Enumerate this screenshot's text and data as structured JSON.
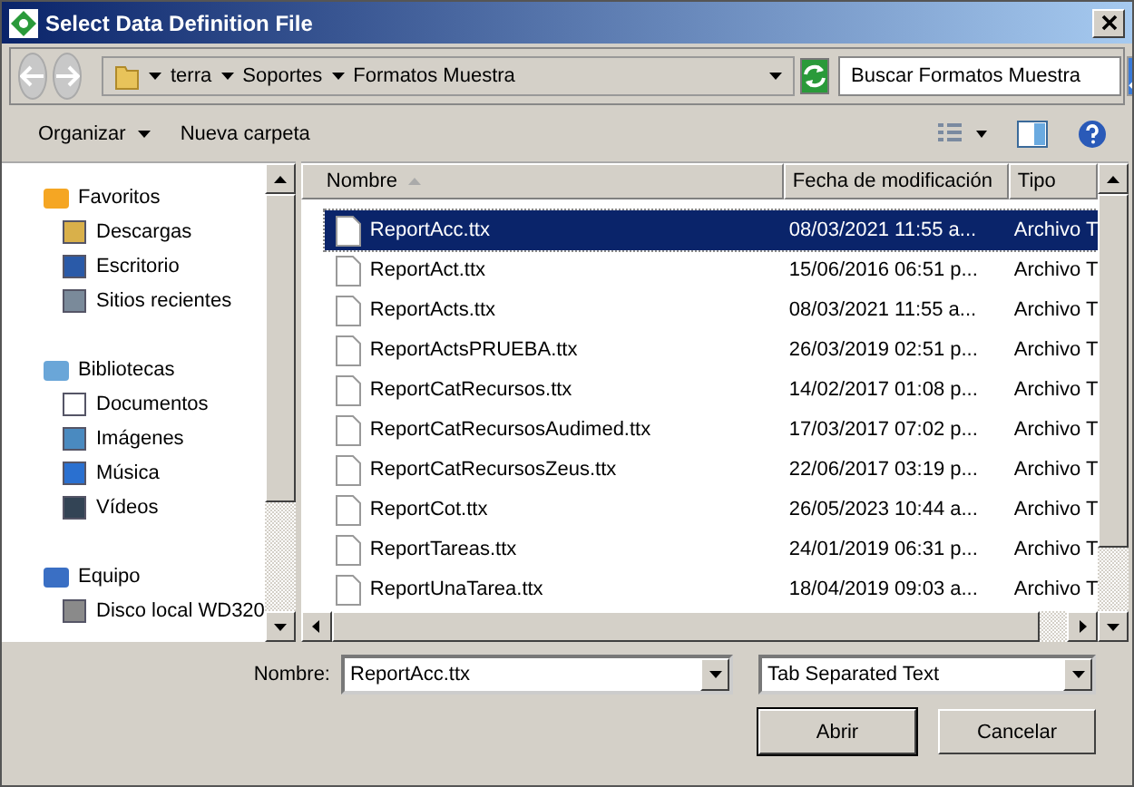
{
  "window": {
    "title": "Select Data Definition File"
  },
  "breadcrumb": [
    "terra",
    "Soportes",
    "Formatos Muestra"
  ],
  "search": {
    "placeholder": "Buscar Formatos Muestra"
  },
  "toolbar": {
    "organize": "Organizar",
    "new_folder": "Nueva carpeta"
  },
  "sidebar": {
    "groups": [
      {
        "label": "Favoritos",
        "children": [
          {
            "label": "Descargas"
          },
          {
            "label": "Escritorio"
          },
          {
            "label": "Sitios recientes"
          }
        ]
      },
      {
        "label": "Bibliotecas",
        "children": [
          {
            "label": "Documentos"
          },
          {
            "label": "Imágenes"
          },
          {
            "label": "Música"
          },
          {
            "label": "Vídeos"
          }
        ]
      },
      {
        "label": "Equipo",
        "children": [
          {
            "label": "Disco local WD320"
          }
        ]
      }
    ]
  },
  "table": {
    "columns": [
      "Nombre",
      "Fecha de modificación",
      "Tipo"
    ],
    "rows": [
      {
        "name": "ReportAcc.ttx",
        "date": "08/03/2021 11:55 a...",
        "type": "Archivo T",
        "selected": true
      },
      {
        "name": "ReportAct.ttx",
        "date": "15/06/2016 06:51 p...",
        "type": "Archivo T",
        "selected": false
      },
      {
        "name": "ReportActs.ttx",
        "date": "08/03/2021 11:55 a...",
        "type": "Archivo T",
        "selected": false
      },
      {
        "name": "ReportActsPRUEBA.ttx",
        "date": "26/03/2019 02:51 p...",
        "type": "Archivo T",
        "selected": false
      },
      {
        "name": "ReportCatRecursos.ttx",
        "date": "14/02/2017 01:08 p...",
        "type": "Archivo T",
        "selected": false
      },
      {
        "name": "ReportCatRecursosAudimed.ttx",
        "date": "17/03/2017 07:02 p...",
        "type": "Archivo T",
        "selected": false
      },
      {
        "name": "ReportCatRecursosZeus.ttx",
        "date": "22/06/2017 03:19 p...",
        "type": "Archivo T",
        "selected": false
      },
      {
        "name": "ReportCot.ttx",
        "date": "26/05/2023 10:44 a...",
        "type": "Archivo T",
        "selected": false
      },
      {
        "name": "ReportTareas.ttx",
        "date": "24/01/2019 06:31 p...",
        "type": "Archivo T",
        "selected": false
      },
      {
        "name": "ReportUnaTarea.ttx",
        "date": "18/04/2019 09:03 a...",
        "type": "Archivo T",
        "selected": false
      }
    ]
  },
  "filename": {
    "label": "Nombre:",
    "value": "ReportAcc.ttx"
  },
  "filetype": {
    "value": "Tab Separated Text"
  },
  "buttons": [
    "Abrir",
    "Cancelar"
  ]
}
